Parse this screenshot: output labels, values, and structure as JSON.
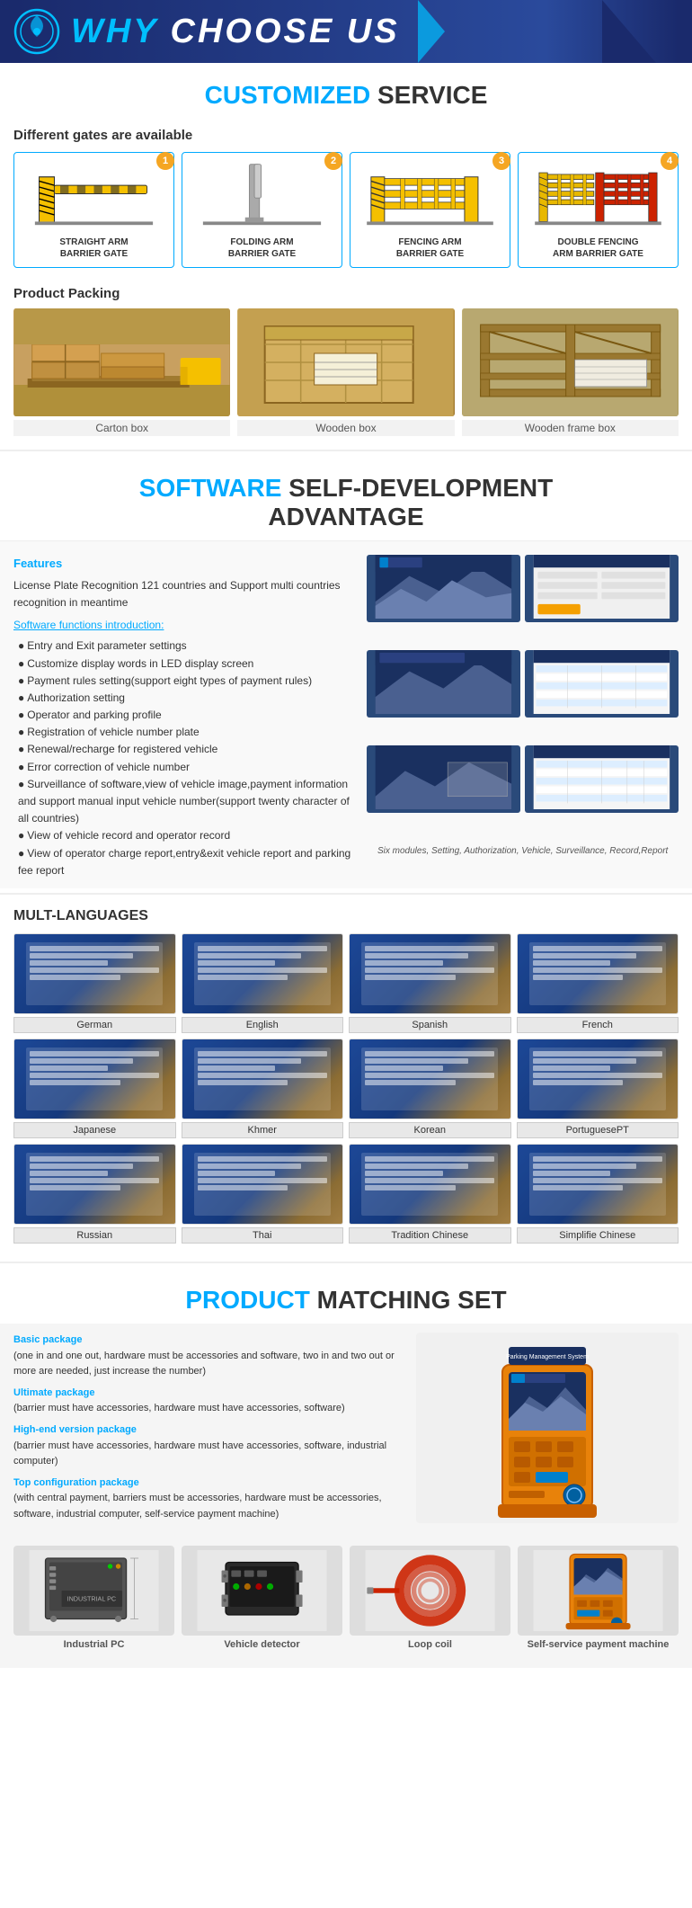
{
  "header": {
    "title": "WHY CHOOSE US",
    "title_highlight": "WHY ",
    "logo_alt": "company-logo"
  },
  "customized_service": {
    "section_title_highlight": "CUSTOMIZED",
    "section_title_rest": " SERVICE",
    "gates_subtitle": "Different gates are available",
    "gates": [
      {
        "number": "1",
        "label": "STRAIGHT ARM\nBARRIER GATE"
      },
      {
        "number": "2",
        "label": "FOLDING ARM\nBARRIER GATE"
      },
      {
        "number": "3",
        "label": "FENCING ARM\nBARRIER GATE"
      },
      {
        "number": "4",
        "label": "DOUBLE FENCING\nARM BARRIER GATE"
      }
    ]
  },
  "product_packing": {
    "title": "Product Packing",
    "items": [
      {
        "label": "Carton box"
      },
      {
        "label": "Wooden box"
      },
      {
        "label": "Wooden frame box"
      }
    ]
  },
  "software": {
    "section_title_highlight": "SOFTWARE",
    "section_title_rest": " SELF-DEVELOPMENT\nADVANTAGE",
    "features_title": "Features",
    "features_desc": "License Plate Recognition 121 countries and Support multi countries recognition in meantime",
    "intro_title": "Software functions introduction:",
    "functions": [
      "Entry and Exit parameter settings",
      "Customize display words in LED display screen",
      "Payment rules setting(support eight types of payment rules)",
      "Authorization setting",
      "Operator and parking profile",
      "Registration of vehicle number plate",
      "Renewal/recharge for registered vehicle",
      "Error correction of vehicle number",
      "Surveillance of software,view of vehicle image,payment information and support manual input vehicle number(support twenty character of all countries)",
      "View of vehicle record and operator record",
      "View of operator charge report,entry&exit vehicle report and parking fee report"
    ],
    "caption": "Six modules, Setting, Authorization, Vehicle,\nSurveillance, Record,Report"
  },
  "languages": {
    "section_title": "MULT-LANGUAGES",
    "items": [
      {
        "label": "German"
      },
      {
        "label": "English"
      },
      {
        "label": "Spanish"
      },
      {
        "label": "French"
      },
      {
        "label": "Japanese"
      },
      {
        "label": "Khmer"
      },
      {
        "label": "Korean"
      },
      {
        "label": "PortuguesePT"
      },
      {
        "label": "Russian"
      },
      {
        "label": "Thai"
      },
      {
        "label": "Tradition Chinese"
      },
      {
        "label": "Simplifie Chinese"
      }
    ]
  },
  "product_matching": {
    "section_title_highlight": "PRODUCT",
    "section_title_rest": " MATCHING SET",
    "packages": [
      {
        "title": "Basic package",
        "desc": "(one in and one out, hardware must be accessories and software, two in and two out or more are needed, just increase the number)"
      },
      {
        "title": "Ultimate package",
        "desc": "(barrier must have accessories, hardware must have accessories, software)"
      },
      {
        "title": "High-end version package",
        "desc": "(barrier must have accessories, hardware must have accessories, software, industrial computer)"
      },
      {
        "title": "Top configuration package",
        "desc": "(with central payment, barriers must be accessories, hardware must be accessories, software, industrial computer, self-service payment machine)"
      }
    ]
  },
  "bottom_products": {
    "items": [
      {
        "label": "Industrial PC"
      },
      {
        "label": "Vehicle detector"
      },
      {
        "label": "Loop coil"
      },
      {
        "label": "Self-service payment machine"
      }
    ]
  },
  "colors": {
    "highlight_blue": "#00aaff",
    "dark_blue": "#1a2a6c",
    "orange": "#f5a623"
  }
}
